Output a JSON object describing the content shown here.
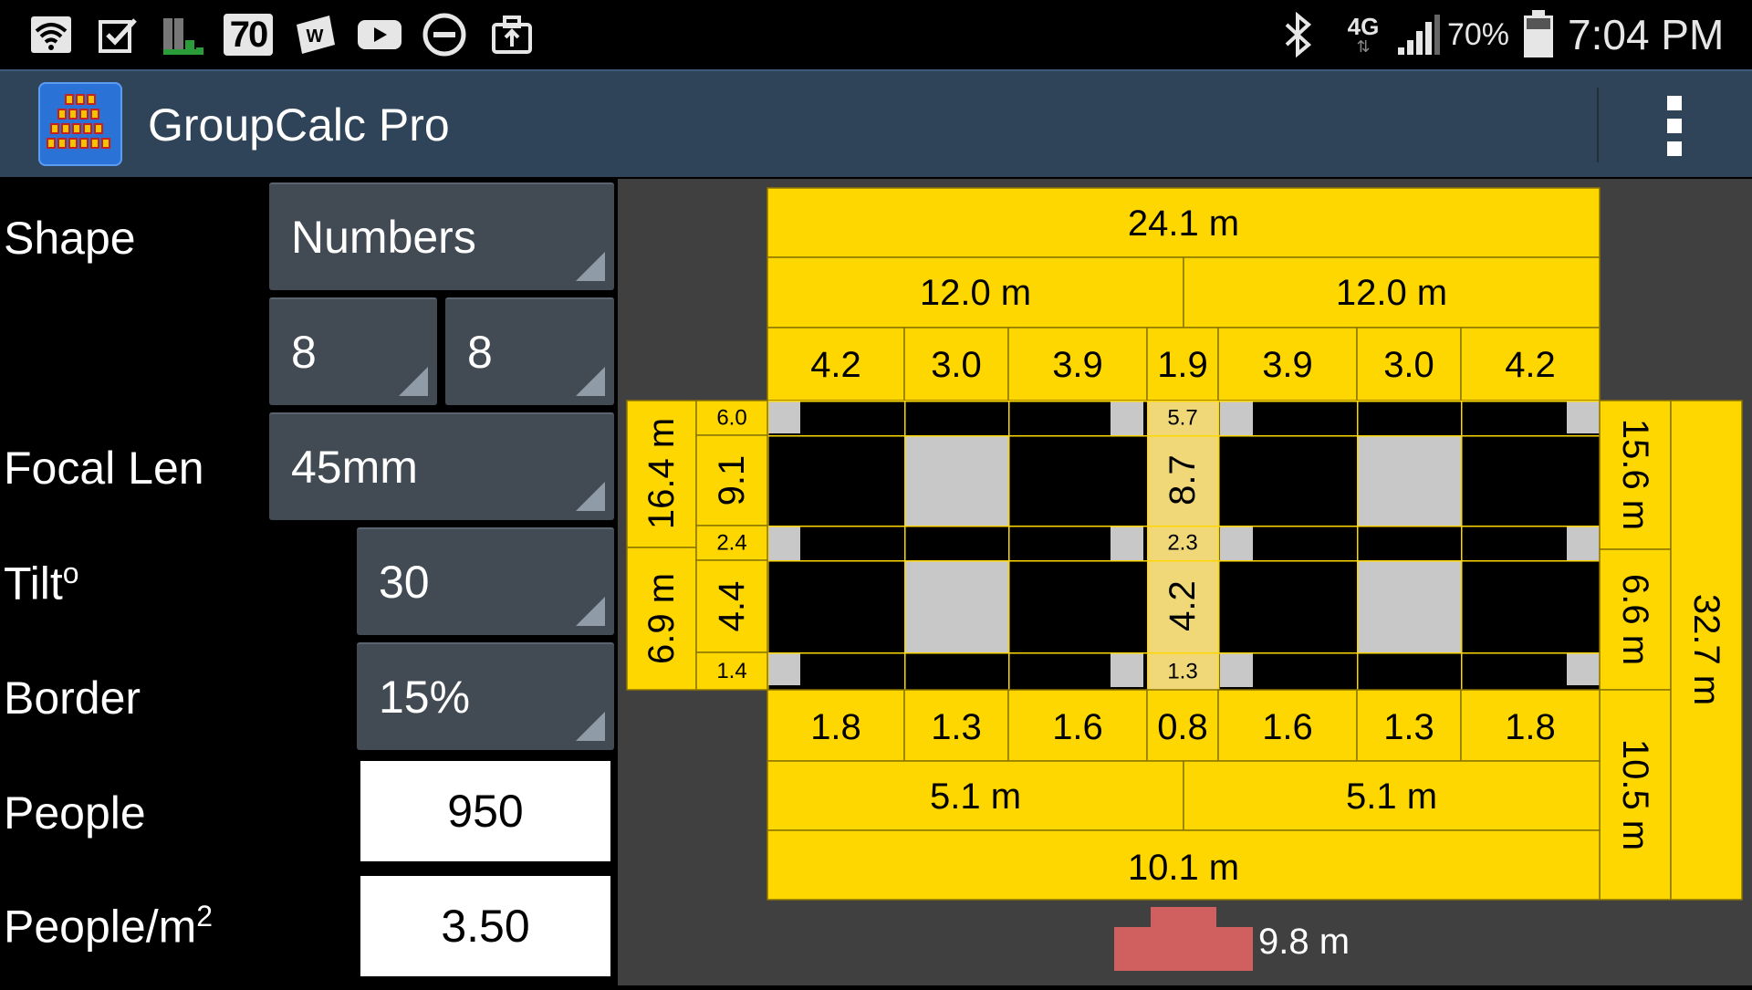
{
  "status_bar": {
    "network": "4G",
    "battery_percent": "70%",
    "time": "7:04 PM",
    "notif_badge": "70"
  },
  "app": {
    "title": "GroupCalc Pro"
  },
  "form": {
    "shape_label": "Shape",
    "shape_value": "Numbers",
    "rows_value": "8",
    "cols_value": "8",
    "focal_label": "Focal Len",
    "focal_value": "45mm",
    "tilt_label": "Tilt",
    "tilt_degree": "o",
    "tilt_value": "30",
    "border_label": "Border",
    "border_value": "15%",
    "people_label": "People",
    "people_value": "950",
    "density_label": "People/m",
    "density_sup": "2",
    "density_value": "3.50"
  },
  "diagram": {
    "top_total": "24.1 m",
    "top_halves": [
      "12.0 m",
      "12.0 m"
    ],
    "top_segments": [
      "4.2",
      "3.0",
      "3.9",
      "1.9",
      "3.9",
      "3.0",
      "4.2"
    ],
    "bottom_segments": [
      "1.8",
      "1.3",
      "1.6",
      "0.8",
      "1.6",
      "1.3",
      "1.8"
    ],
    "bottom_halves": [
      "5.1 m",
      "5.1 m"
    ],
    "bottom_total": "10.1 m",
    "left_outer": [
      "16.4 m",
      "6.9 m"
    ],
    "left_inner": [
      "6.0",
      "9.1",
      "2.4",
      "4.4",
      "1.4"
    ],
    "center_col": [
      "5.7",
      "8.7",
      "2.3",
      "4.2",
      "1.3"
    ],
    "right_inner": [
      "15.6 m",
      "6.6 m",
      "10.5 m"
    ],
    "right_total": "32.7 m",
    "camera_distance": "9.8 m",
    "colors": {
      "yellow": "#ffd700",
      "pale_yellow": "#f0d878",
      "black": "#000000",
      "gray": "#c8c8c8",
      "background": "#404040",
      "camera": "#d06060"
    }
  }
}
